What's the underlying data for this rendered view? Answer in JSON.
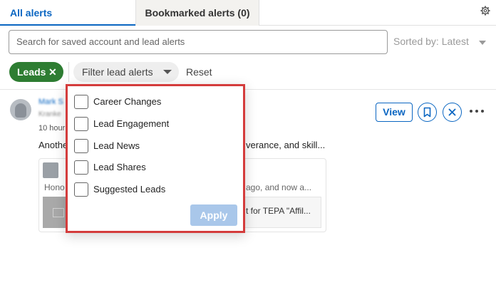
{
  "tabs": {
    "all_alerts": "All alerts",
    "bookmarked": "Bookmarked alerts (0)"
  },
  "search": {
    "placeholder": "Search for saved account and lead alerts",
    "sort_label": "Sorted by: Latest"
  },
  "filters": {
    "chip_label": "Leads",
    "chip_remove": "✕",
    "filter_button": "Filter lead alerts",
    "reset": "Reset"
  },
  "alert": {
    "name": "Mark S",
    "subtitle": "Kranke",
    "time": "10 hour",
    "text_left": "Anothe",
    "text_right": "verance, and skill...",
    "card_text_left": "Hono",
    "card_text_right": "ago, and now a...",
    "inner_text_right": "t for TEPA \"Affil...",
    "view_label": "View"
  },
  "dropdown": {
    "options": [
      {
        "label": "Career Changes",
        "checked": false
      },
      {
        "label": "Lead Engagement",
        "checked": false
      },
      {
        "label": "Lead News",
        "checked": false
      },
      {
        "label": "Lead Shares",
        "checked": false
      },
      {
        "label": "Suggested Leads",
        "checked": false
      }
    ],
    "apply_label": "Apply"
  },
  "colors": {
    "accent": "#0a66c2",
    "chip_green": "#2e7d32",
    "highlight_border": "#d43c3c",
    "apply_disabled": "#a9c7ea"
  }
}
